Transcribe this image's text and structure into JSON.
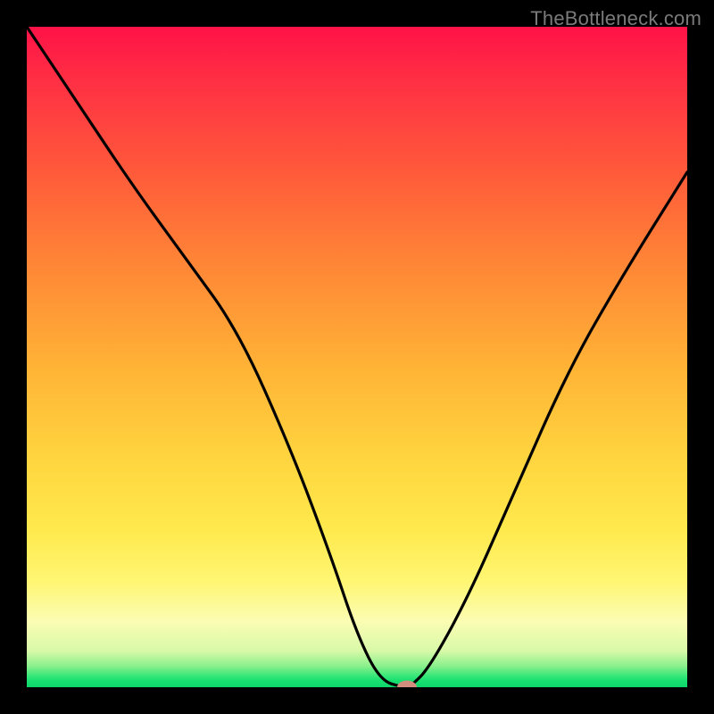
{
  "watermark": "TheBottleneck.com",
  "chart_data": {
    "type": "line",
    "title": "",
    "xlabel": "",
    "ylabel": "",
    "xlim": [
      0,
      100
    ],
    "ylim": [
      0,
      100
    ],
    "x": [
      0,
      8,
      16,
      24,
      32,
      40,
      46,
      50,
      53.5,
      57,
      58,
      61,
      67,
      74,
      82,
      90,
      100
    ],
    "y": [
      100,
      88,
      76,
      65,
      54,
      36,
      20,
      8,
      1,
      0,
      0,
      3,
      14,
      30,
      48,
      62,
      78
    ],
    "marker": {
      "x": 57.5,
      "y": 0
    }
  },
  "colors": {
    "curve": "#000000",
    "marker": "#d28d7e",
    "background": "#000000"
  }
}
